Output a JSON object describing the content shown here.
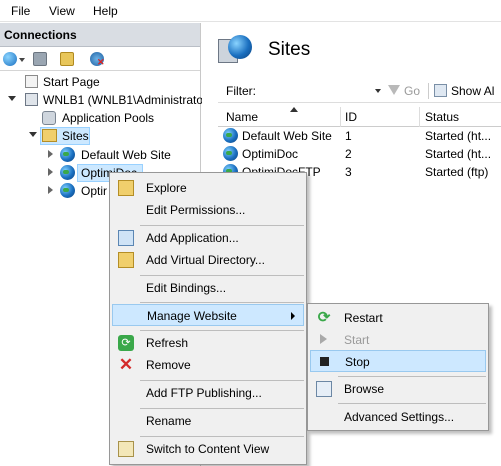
{
  "menubar": {
    "file": "File",
    "view": "View",
    "help": "Help"
  },
  "connections": {
    "title": "Connections",
    "tree": {
      "start_page": "Start Page",
      "server": "WNLB1 (WNLB1\\Administrato",
      "app_pools": "Application Pools",
      "sites": "Sites",
      "site1": "Default Web Site",
      "site2": "OptimiDoc",
      "site3": "Optir"
    }
  },
  "sites_pane": {
    "title": "Sites",
    "filter_label": "Filter:",
    "go": "Go",
    "show_all": "Show Al",
    "columns": [
      "Name",
      "ID",
      "Status"
    ],
    "rows": [
      {
        "name": "Default Web Site",
        "id": "1",
        "status": "Started (ht..."
      },
      {
        "name": "OptimiDoc",
        "id": "2",
        "status": "Started (ht..."
      },
      {
        "name": "OptimiDocFTP",
        "id": "3",
        "status": "Started (ftp)"
      }
    ]
  },
  "context_menu": {
    "explore": "Explore",
    "edit_permissions": "Edit Permissions...",
    "add_application": "Add Application...",
    "add_virtual_directory": "Add Virtual Directory...",
    "edit_bindings": "Edit Bindings...",
    "manage_website": "Manage Website",
    "refresh": "Refresh",
    "remove": "Remove",
    "add_ftp_publishing": "Add FTP Publishing...",
    "rename": "Rename",
    "switch_content_view": "Switch to Content View"
  },
  "submenu": {
    "restart": "Restart",
    "start": "Start",
    "stop": "Stop",
    "browse": "Browse",
    "advanced_settings": "Advanced Settings..."
  },
  "colors": {
    "highlight": "#cde8ff",
    "header_bg": "#d9dde3"
  }
}
